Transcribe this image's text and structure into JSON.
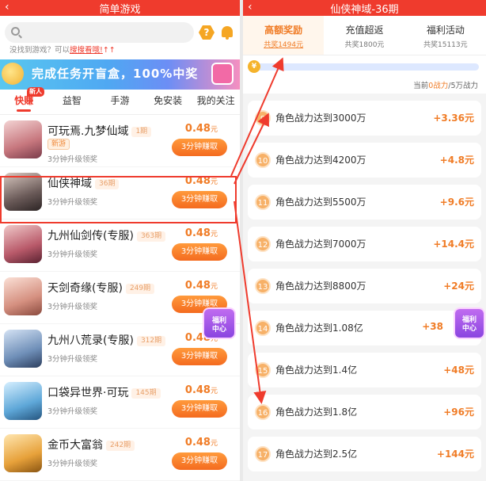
{
  "left": {
    "title": "简单游戏",
    "back_glyph": "‹",
    "help_glyph": "?",
    "hint_prefix": "没找到游戏？可以",
    "hint_link": "搜搜看哦!",
    "hint_arrows": "↑↑",
    "banner_text": "完成任务开盲盒，100%中奖",
    "tabs": [
      {
        "label": "快赚",
        "badge": "新人"
      },
      {
        "label": "益智"
      },
      {
        "label": "手游"
      },
      {
        "label": "免安装"
      },
      {
        "label": "我的关注"
      }
    ],
    "games": [
      {
        "name": "可玩焉.九梦仙域",
        "period": "1期",
        "tag": "新游",
        "desc": "3分钟升级领奖",
        "price": "0.48",
        "unit": "元",
        "button": "3分钟赚取",
        "color": "#c7777e"
      },
      {
        "name": "仙侠神域",
        "period": "36期",
        "desc": "3分钟升级领奖",
        "price": "0.48",
        "unit": "元",
        "button": "3分钟赚取",
        "color": "#6a5a58"
      },
      {
        "name": "九州仙剑传(专服)",
        "period": "363期",
        "desc": "3分钟升级领奖",
        "price": "0.48",
        "unit": "元",
        "button": "3分钟赚取",
        "color": "#b95a6a"
      },
      {
        "name": "天剑奇缘(专服)",
        "period": "249期",
        "desc": "3分钟升级领奖",
        "price": "0.48",
        "unit": "元",
        "button": "3分钟赚取",
        "color": "#d59080"
      },
      {
        "name": "九州八荒录(专服)",
        "period": "312期",
        "desc": "3分钟升级领奖",
        "price": "0.48",
        "unit": "元",
        "button": "3分钟赚取",
        "color": "#6f8fb8"
      },
      {
        "name": "口袋异世界·可玩",
        "period": "145期",
        "desc": "3分钟升级领奖",
        "price": "0.48",
        "unit": "元",
        "button": "3分钟赚取",
        "color": "#5ea7d8"
      },
      {
        "name": "金币大富翁",
        "period": "242期",
        "desc": "3分钟升级领奖",
        "price": "0.48",
        "unit": "元",
        "button": "3分钟赚取",
        "color": "#e7a13a"
      }
    ],
    "float_label_1": "福利",
    "float_label_2": "中心"
  },
  "right": {
    "title": "仙侠神域-36期",
    "back_glyph": "‹",
    "tabs": [
      {
        "label": "高额奖励",
        "sub": "共奖1494元"
      },
      {
        "label": "充值超返",
        "sub": "共奖1800元"
      },
      {
        "label": "福利活动",
        "sub": "共奖15113元"
      }
    ],
    "coin_glyph": "¥",
    "progress": 0.0,
    "power_prefix": "当前",
    "power_current": "0战力",
    "power_suffix": "/5万战力",
    "tasks": [
      {
        "num": "9",
        "label": "角色战力达到3000万",
        "reward": "+3.36元"
      },
      {
        "num": "10",
        "label": "角色战力达到4200万",
        "reward": "+4.8元"
      },
      {
        "num": "11",
        "label": "角色战力达到5500万",
        "reward": "+9.6元"
      },
      {
        "num": "12",
        "label": "角色战力达到7000万",
        "reward": "+14.4元"
      },
      {
        "num": "13",
        "label": "角色战力达到8800万",
        "reward": "+24元"
      },
      {
        "num": "14",
        "label": "角色战力达到1.08亿",
        "reward": "+38"
      },
      {
        "num": "15",
        "label": "角色战力达到1.4亿",
        "reward": "+48元"
      },
      {
        "num": "16",
        "label": "角色战力达到1.8亿",
        "reward": "+96元"
      },
      {
        "num": "17",
        "label": "角色战力达到2.5亿",
        "reward": "+144元"
      }
    ],
    "float_label_1": "福利",
    "float_label_2": "中心"
  },
  "colors": {
    "accent": "#ef3b2d",
    "orange": "#f07c26",
    "gold": "#f5b32c"
  }
}
